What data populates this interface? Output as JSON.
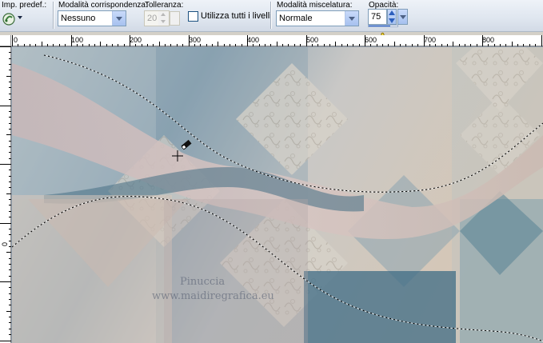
{
  "toolbar": {
    "preset_label": "Imp. predef.:",
    "match_mode_label": "Modalità corrispondenza:",
    "match_mode_value": "Nessuno",
    "tolerance_label": "Tolleranza:",
    "tolerance_value": "20",
    "use_all_layers_label": "Utilizza tutti i livelli",
    "use_all_layers_checked": false,
    "blend_mode_label": "Modalità miscelatura:",
    "blend_mode_value": "Normale",
    "opacity_label": "Opacità:",
    "opacity_value": "75",
    "opacity_fraction": 0.75
  },
  "ruler": {
    "top_labels": [
      "0",
      "100",
      "200",
      "300",
      "400",
      "500",
      "600",
      "700",
      "800"
    ]
  },
  "canvas": {
    "watermark_name": "Pinuccia",
    "watermark_url": "www.maidiregrafica.eu"
  },
  "colors": {
    "accent": "#3168d5",
    "toolbar_bg": "#dfe6ef",
    "canvas_teal": "#5e8396",
    "canvas_rose": "#cdb9b8",
    "canvas_beige": "#d9c9b7"
  },
  "icons": {
    "preset": "preset-icon",
    "hand_cursor": "hand-pointer-icon",
    "crosshair_cursor": "crosshair-cursor-icon"
  }
}
